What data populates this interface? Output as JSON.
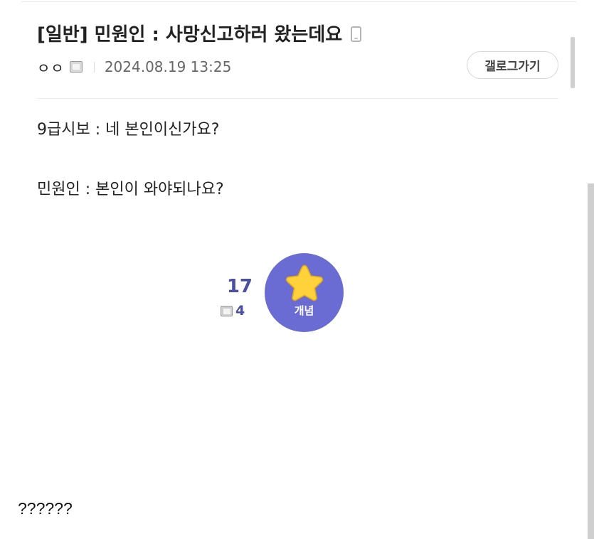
{
  "post": {
    "title": "[일반] 민원인 : 사망신고하러 왔는데요",
    "author": "ㅇㅇ",
    "date": "2024.08.19 13:25",
    "gallery_button_label": "갤로그가기",
    "title_icon": "mobile-device-icon",
    "author_icon": "fixed-nick-icon",
    "body_lines": [
      "9급시보 : 네 본인이신가요?",
      "민원인 : 본인이 와야되나요?"
    ]
  },
  "recommend": {
    "count": "17",
    "fixed_count": "4",
    "label": "개념",
    "button_color": "#6b6bd4",
    "star_color": "#ffd23c",
    "count_color": "#4a4fa3"
  },
  "caption": "??????"
}
